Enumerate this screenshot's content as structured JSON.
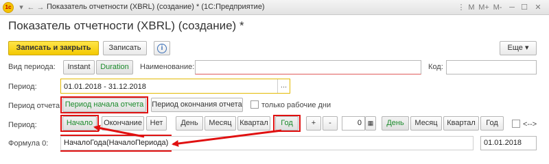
{
  "window": {
    "title": "Показатель отчетности (XBRL) (создание) * (1С:Предприятие)",
    "app_logo_text": "1c",
    "controls": {
      "menu": "▾",
      "min": "─",
      "max": "☐",
      "close": "✕"
    },
    "toolbar_icons": [
      "⋮",
      "M",
      "M+",
      "M-"
    ]
  },
  "form": {
    "title": "Показатель отчетности (XBRL) (создание) *",
    "toolbar": {
      "save_close": "Записать и закрыть",
      "save": "Записать",
      "info_icon": "i",
      "more": "Еще ▾"
    },
    "period_kind": {
      "label": "Вид периода:",
      "options": [
        "Instant",
        "Duration"
      ],
      "selected": "Duration"
    },
    "name": {
      "label": "Наименование:",
      "value": ""
    },
    "code": {
      "label": "Код:",
      "value": ""
    },
    "period": {
      "label": "Период:",
      "value": "01.01.2018 - 31.12.2018",
      "button": "..."
    },
    "report_period": {
      "label": "Период отчета:",
      "options": [
        "Период начала отчета",
        "Период окончания отчета"
      ],
      "selected": "Период начала отчета",
      "workdays_label": "только рабочие дни",
      "workdays_checked": false
    },
    "period_row": {
      "label": "Период:",
      "point_options": [
        "Начало",
        "Окончание",
        "Нет"
      ],
      "point_selected": "Начало",
      "unit_options": [
        "День",
        "Месяц",
        "Квартал",
        "Год"
      ],
      "unit_selected": "Год",
      "plus": "+",
      "minus": "-",
      "offset": "0",
      "unit2_options": [
        "День",
        "Месяц",
        "Квартал",
        "Год"
      ],
      "unit2_selected": "День",
      "arrow_label": "<-->",
      "arrow_checked": false
    },
    "formula": {
      "label": "Формула 0:",
      "value": "НачалоГода(НачалоПериода)",
      "result": "01.01.2018"
    }
  },
  "colors": {
    "accent_yellow": "#f3c900",
    "selected_green": "#1a8a2a",
    "highlight_red": "#e01010"
  }
}
